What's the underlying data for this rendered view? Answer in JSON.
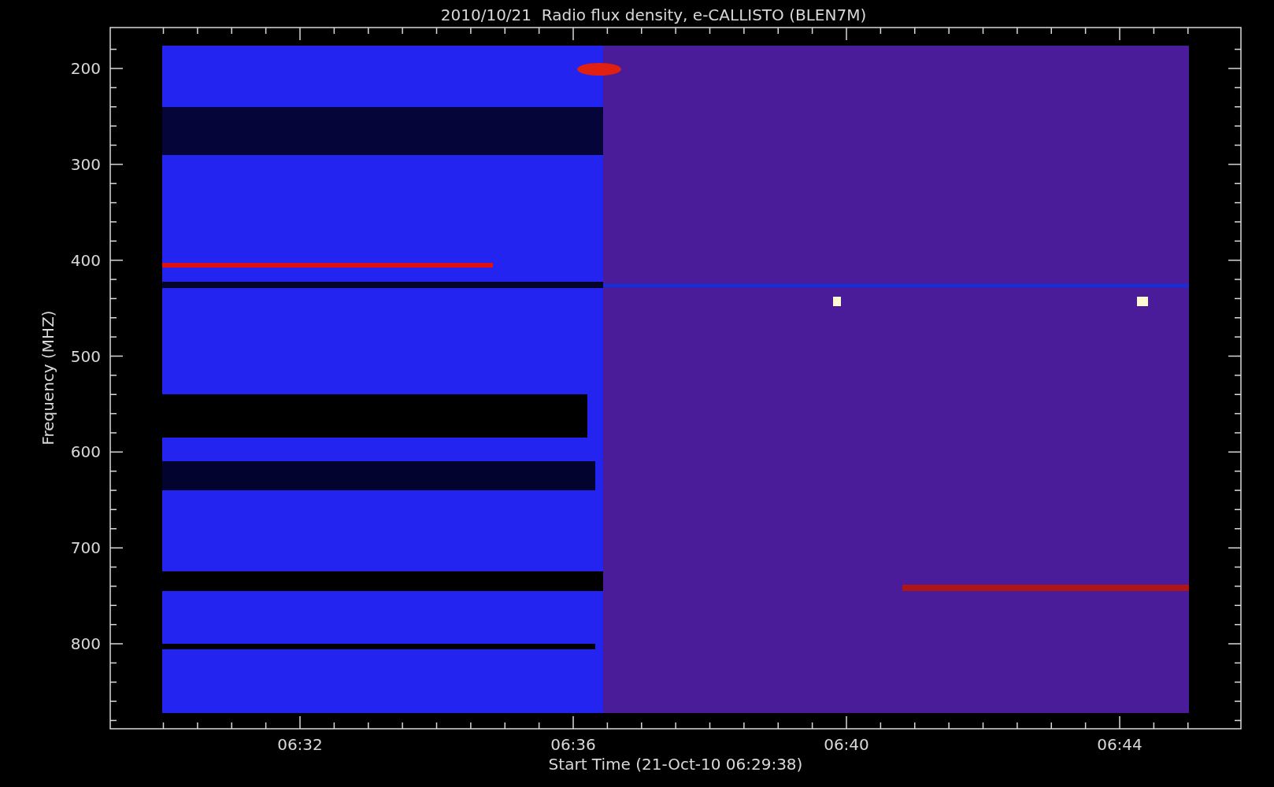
{
  "title": "2010/10/21  Radio flux density, e-CALLISTO (BLEN7M)",
  "y_axis": {
    "label": "Frequency (MHZ)",
    "ticks": [
      "200",
      "300",
      "400",
      "500",
      "600",
      "700",
      "800"
    ]
  },
  "x_axis": {
    "label": "Start Time (21-Oct-10 06:29:38)",
    "ticks": [
      "06:32",
      "06:36",
      "06:40",
      "06:44"
    ]
  }
}
